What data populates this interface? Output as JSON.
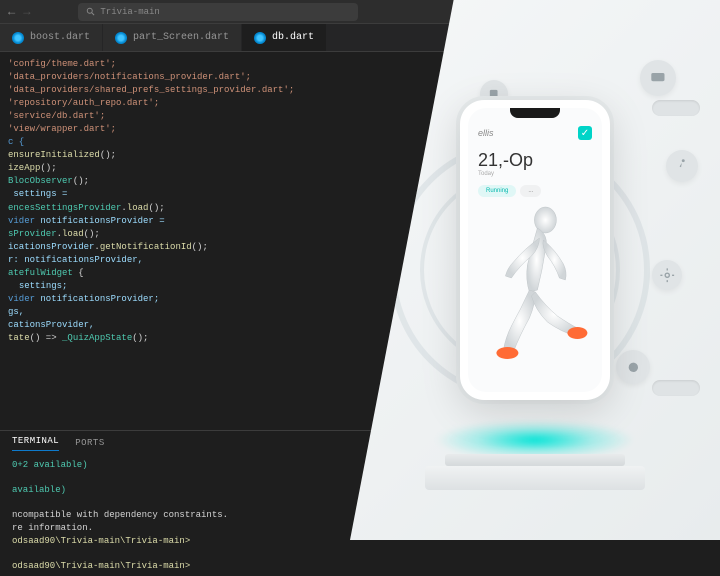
{
  "topbar": {
    "search_text": "Trivia-main"
  },
  "tabs": [
    {
      "label": "boost.dart",
      "active": false
    },
    {
      "label": "part_Screen.dart",
      "active": false
    },
    {
      "label": "db.dart",
      "active": true
    }
  ],
  "code": [
    [
      [
        "s-import",
        "'config/theme.dart';"
      ]
    ],
    [
      [
        "s-import",
        "'data_providers/notifications_provider.dart';"
      ]
    ],
    [
      [
        "s-import",
        "'data_providers/shared_prefs_settings_provider.dart';"
      ]
    ],
    [
      [
        "s-import",
        "'repository/auth_repo.dart';"
      ]
    ],
    [
      [
        "s-import",
        "'service/db.dart';"
      ]
    ],
    [
      [
        "s-import",
        "'view/wrapper.dart';"
      ]
    ],
    [
      [
        "",
        ""
      ]
    ],
    [
      [
        "s-keyword",
        "c {"
      ]
    ],
    [
      [
        "s-func",
        "ensureInitialized"
      ],
      [
        "s-punc",
        "();"
      ]
    ],
    [
      [
        "s-func",
        "izeApp"
      ],
      [
        "s-punc",
        "();"
      ]
    ],
    [
      [
        "s-type",
        "BlocObserver"
      ],
      [
        "s-punc",
        "();"
      ]
    ],
    [
      [
        "",
        ""
      ]
    ],
    [
      [
        "s-method",
        " settings ="
      ]
    ],
    [
      [
        "s-type",
        "encesSettingsProvider"
      ],
      [
        "s-punc",
        "."
      ],
      [
        "s-func",
        "load"
      ],
      [
        "s-punc",
        "();"
      ]
    ],
    [
      [
        "s-keyword",
        "vider "
      ],
      [
        "s-method",
        "notificationsProvider ="
      ]
    ],
    [
      [
        "s-type",
        "sProvider"
      ],
      [
        "s-punc",
        "."
      ],
      [
        "s-func",
        "load"
      ],
      [
        "s-punc",
        "();"
      ]
    ],
    [
      [
        "s-method",
        "icationsProvider"
      ],
      [
        "s-punc",
        "."
      ],
      [
        "s-func",
        "getNotificationId"
      ],
      [
        "s-punc",
        "();"
      ]
    ],
    [
      [
        "",
        ""
      ]
    ],
    [
      [
        "",
        ""
      ]
    ],
    [
      [
        "s-method",
        "r: notificationsProvider,"
      ]
    ],
    [
      [
        "",
        ""
      ]
    ],
    [
      [
        "",
        ""
      ]
    ],
    [
      [
        "s-type",
        "atefulWidget "
      ],
      [
        "s-punc",
        "{"
      ]
    ],
    [
      [
        "s-keyword",
        "  "
      ],
      [
        "s-method",
        "settings;"
      ]
    ],
    [
      [
        "s-keyword",
        "vider "
      ],
      [
        "s-method",
        "notificationsProvider;"
      ]
    ],
    [
      [
        "",
        ""
      ]
    ],
    [
      [
        "s-method",
        "gs,"
      ]
    ],
    [
      [
        "s-method",
        "cationsProvider,"
      ]
    ],
    [
      [
        "",
        ""
      ]
    ],
    [
      [
        "",
        ""
      ]
    ],
    [
      [
        "s-func",
        "tate"
      ],
      [
        "s-punc",
        "() => "
      ],
      [
        "s-type",
        "_QuizAppState"
      ],
      [
        "s-punc",
        "();"
      ]
    ]
  ],
  "terminal": {
    "tabs": [
      "TERMINAL",
      "PORTS"
    ],
    "lines": [
      {
        "cls": "term-good",
        "text": "0+2 available)"
      },
      {
        "cls": "",
        "text": ""
      },
      {
        "cls": "term-good",
        "text": "available)"
      },
      {
        "cls": "",
        "text": ""
      },
      {
        "cls": "",
        "text": "ncompatible with dependency constraints."
      },
      {
        "cls": "",
        "text": "re information."
      },
      {
        "cls": "term-path",
        "text": "odsaad90\\Trivia-main\\Trivia-main>"
      },
      {
        "cls": "",
        "text": ""
      },
      {
        "cls": "term-path",
        "text": "odsaad90\\Trivia-main\\Trivia-main>"
      }
    ]
  },
  "phone": {
    "logo": "ellis",
    "time": "21,-Op",
    "subtitle": "Today",
    "tabs": [
      "Running",
      "..."
    ]
  }
}
